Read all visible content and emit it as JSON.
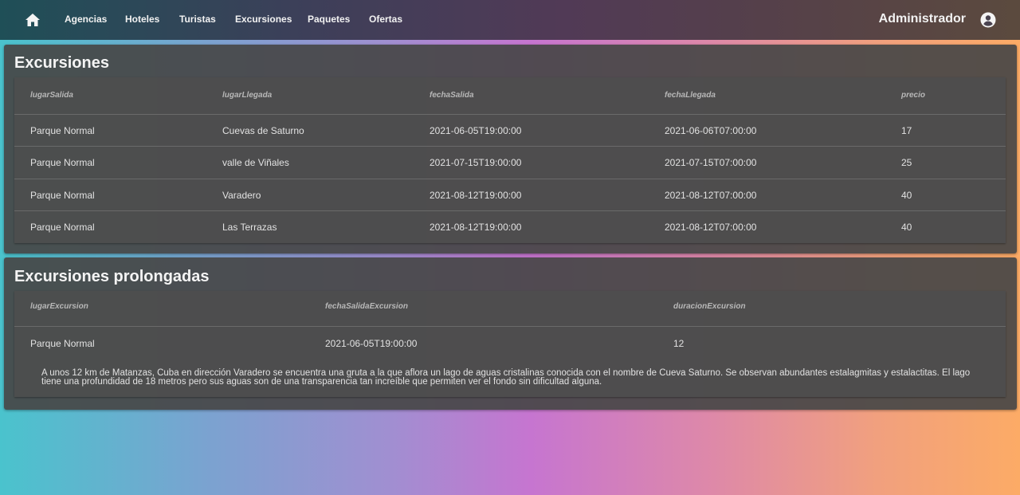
{
  "nav": {
    "home_icon": "home-icon",
    "items": [
      "Agencias",
      "Hoteles",
      "Turistas",
      "Excursiones",
      "Paquetes",
      "Ofertas"
    ],
    "user_name": "Administrador",
    "account_icon": "account-circle-icon"
  },
  "excursiones": {
    "title": "Excursiones",
    "columns": [
      "lugarSalida",
      "lugarLlegada",
      "fechaSalida",
      "fechaLlegada",
      "precio"
    ],
    "rows": [
      [
        "Parque Normal",
        "Cuevas de Saturno",
        "2021-06-05T19:00:00",
        "2021-06-06T07:00:00",
        "17"
      ],
      [
        "Parque Normal",
        "valle de Viñales",
        "2021-07-15T19:00:00",
        "2021-07-15T07:00:00",
        "25"
      ],
      [
        "Parque Normal",
        "Varadero",
        "2021-08-12T19:00:00",
        "2021-08-12T07:00:00",
        "40"
      ],
      [
        "Parque Normal",
        "Las Terrazas",
        "2021-08-12T19:00:00",
        "2021-08-12T07:00:00",
        "40"
      ]
    ]
  },
  "prolongadas": {
    "title": "Excursiones prolongadas",
    "columns": [
      "lugarExcursion",
      "fechaSalidaExcursion",
      "duracionExcursion"
    ],
    "rows": [
      {
        "cells": [
          "Parque Normal",
          "2021-06-05T19:00:00",
          "12"
        ],
        "description": "A unos 12 km de Matanzas, Cuba en dirección Varadero se encuentra una gruta a la que aflora un lago de aguas cristalinas conocida con el nombre de Cueva Saturno. Se observan abundantes estalagmitas y estalactitas. El lago tiene una profundidad de 18 metros pero sus aguas son de una transparencia tan increíble que permiten ver el fondo sin dificultad alguna."
      }
    ]
  }
}
